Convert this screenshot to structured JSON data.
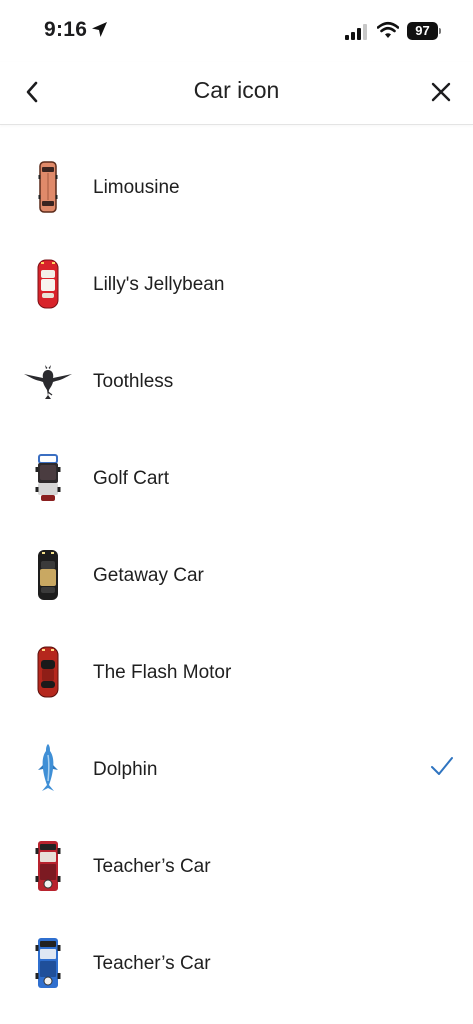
{
  "status_bar": {
    "time": "9:16",
    "battery": "97"
  },
  "nav": {
    "title": "Car icon",
    "back_icon": "chevron-left-icon",
    "close_icon": "close-icon"
  },
  "colors": {
    "accent": "#2f74c0",
    "divider": "#e4e4e4"
  },
  "items": [
    {
      "label": "Limousine",
      "icon": "limousine-icon",
      "selected": false
    },
    {
      "label": "Lilly's Jellybean",
      "icon": "red-car-icon",
      "selected": false
    },
    {
      "label": "Toothless",
      "icon": "dragon-icon",
      "selected": false
    },
    {
      "label": "Golf Cart",
      "icon": "golf-cart-icon",
      "selected": false
    },
    {
      "label": "Getaway Car",
      "icon": "black-car-icon",
      "selected": false
    },
    {
      "label": "The Flash Motor",
      "icon": "red-sports-car-icon",
      "selected": false
    },
    {
      "label": "Dolphin",
      "icon": "dolphin-icon",
      "selected": true
    },
    {
      "label": "Teacher’s Car",
      "icon": "red-jeep-icon",
      "selected": false
    },
    {
      "label": "Teacher’s Car",
      "icon": "blue-jeep-icon",
      "selected": false
    }
  ]
}
